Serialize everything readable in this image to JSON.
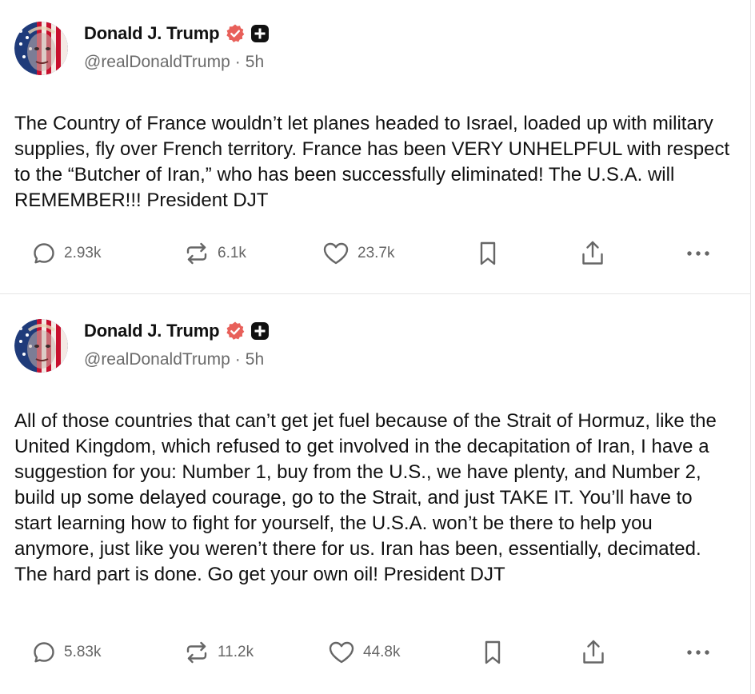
{
  "posts": [
    {
      "author": {
        "display_name": "Donald J. Trump",
        "handle": "@realDonaldTrump",
        "verified_icon": "verified-badge-icon",
        "extra_badge_icon": "plus-badge-icon"
      },
      "separator": "·",
      "time": "5h",
      "text": "The Country of France wouldn’t let planes headed to Israel, loaded up with military supplies, fly over French territory. France has been VERY UNHELPFUL with respect to the “Butcher of Iran,” who has been successfully eliminated! The U.S.A. will REMEMBER!!! President DJT",
      "stats": {
        "replies": "2.93k",
        "retruths": "6.1k",
        "likes": "23.7k"
      }
    },
    {
      "author": {
        "display_name": "Donald J. Trump",
        "handle": "@realDonaldTrump",
        "verified_icon": "verified-badge-icon",
        "extra_badge_icon": "plus-badge-icon"
      },
      "separator": "·",
      "time": "5h",
      "text": "All of those countries that can’t get jet fuel because of the Strait of Hormuz, like the United Kingdom, which refused to get involved in the decapitation of Iran, I have a suggestion for you: Number 1, buy from the U.S., we have plenty, and Number 2, build up some delayed courage, go to the Strait, and just TAKE IT. You’ll have to start learning how to fight for yourself, the U.S.A. won’t be there to help you anymore, just like you weren’t there for us. Iran has been, essentially, decimated. The hard part is done. Go get your own oil! President DJT",
      "stats": {
        "replies": "5.83k",
        "retruths": "11.2k",
        "likes": "44.8k"
      }
    }
  ],
  "colors": {
    "text": "#111111",
    "muted": "#6b6b6b",
    "icon": "#666666",
    "verified": "#e8605a",
    "divider": "#e6e6e6"
  },
  "icons": {
    "reply": "comment-bubble-icon",
    "retruth": "repost-arrows-icon",
    "like": "heart-icon",
    "bookmark": "bookmark-icon",
    "share": "share-upload-icon",
    "more": "more-dots-icon"
  }
}
